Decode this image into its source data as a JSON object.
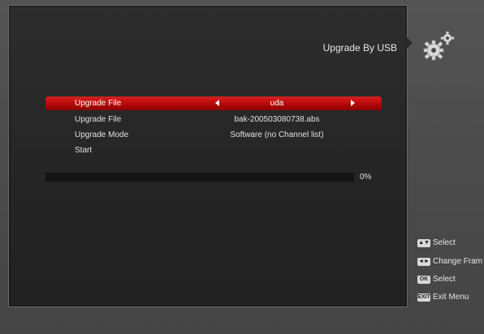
{
  "screen": {
    "title": "Upgrade By USB"
  },
  "menu": {
    "items": [
      {
        "label": "Upgrade File",
        "value": "uda",
        "selected": true
      },
      {
        "label": "Upgrade File",
        "value": "bak-200503080738.abs",
        "selected": false
      },
      {
        "label": "Upgrade Mode",
        "value": "Software (no Channel list)",
        "selected": false
      },
      {
        "label": "Start",
        "value": "",
        "selected": false
      }
    ]
  },
  "progress": {
    "percent": 0,
    "label": "0%"
  },
  "help": {
    "items": [
      {
        "key": "▲▼",
        "icon": "up-down-key-icon",
        "text": "Select"
      },
      {
        "key": "◄►",
        "icon": "left-right-key-icon",
        "text": "Change Fram"
      },
      {
        "key": "OK",
        "icon": "ok-key-icon",
        "text": "Select"
      },
      {
        "key": "EXIT",
        "icon": "exit-key-icon",
        "text": "Exit Menu"
      }
    ]
  },
  "colors": {
    "highlight": "#c01010",
    "panel": "#262626",
    "background": "#4b4b4b"
  }
}
